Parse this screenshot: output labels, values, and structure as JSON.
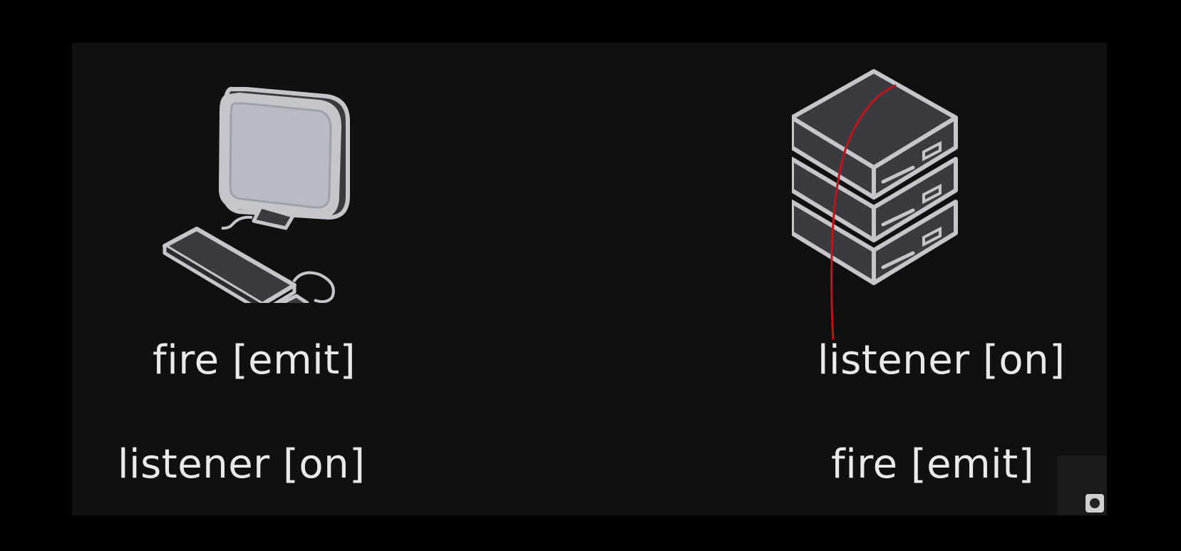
{
  "client": {
    "icon": "desktop-computer-icon",
    "fire_label": "fire [emit]",
    "listen_label": "listener [on]"
  },
  "server": {
    "icon": "server-stack-icon",
    "listen_label": "listener [on]",
    "fire_label": "fire [emit]"
  },
  "colors": {
    "background": "#000000",
    "panel": "#101010",
    "text": "#e9e9e9",
    "icon_stroke": "#c4c6cc",
    "icon_fill_dark": "#3a3b40",
    "screen_fill": "#b8bbc2",
    "annotation_stroke": "#c0141b"
  }
}
